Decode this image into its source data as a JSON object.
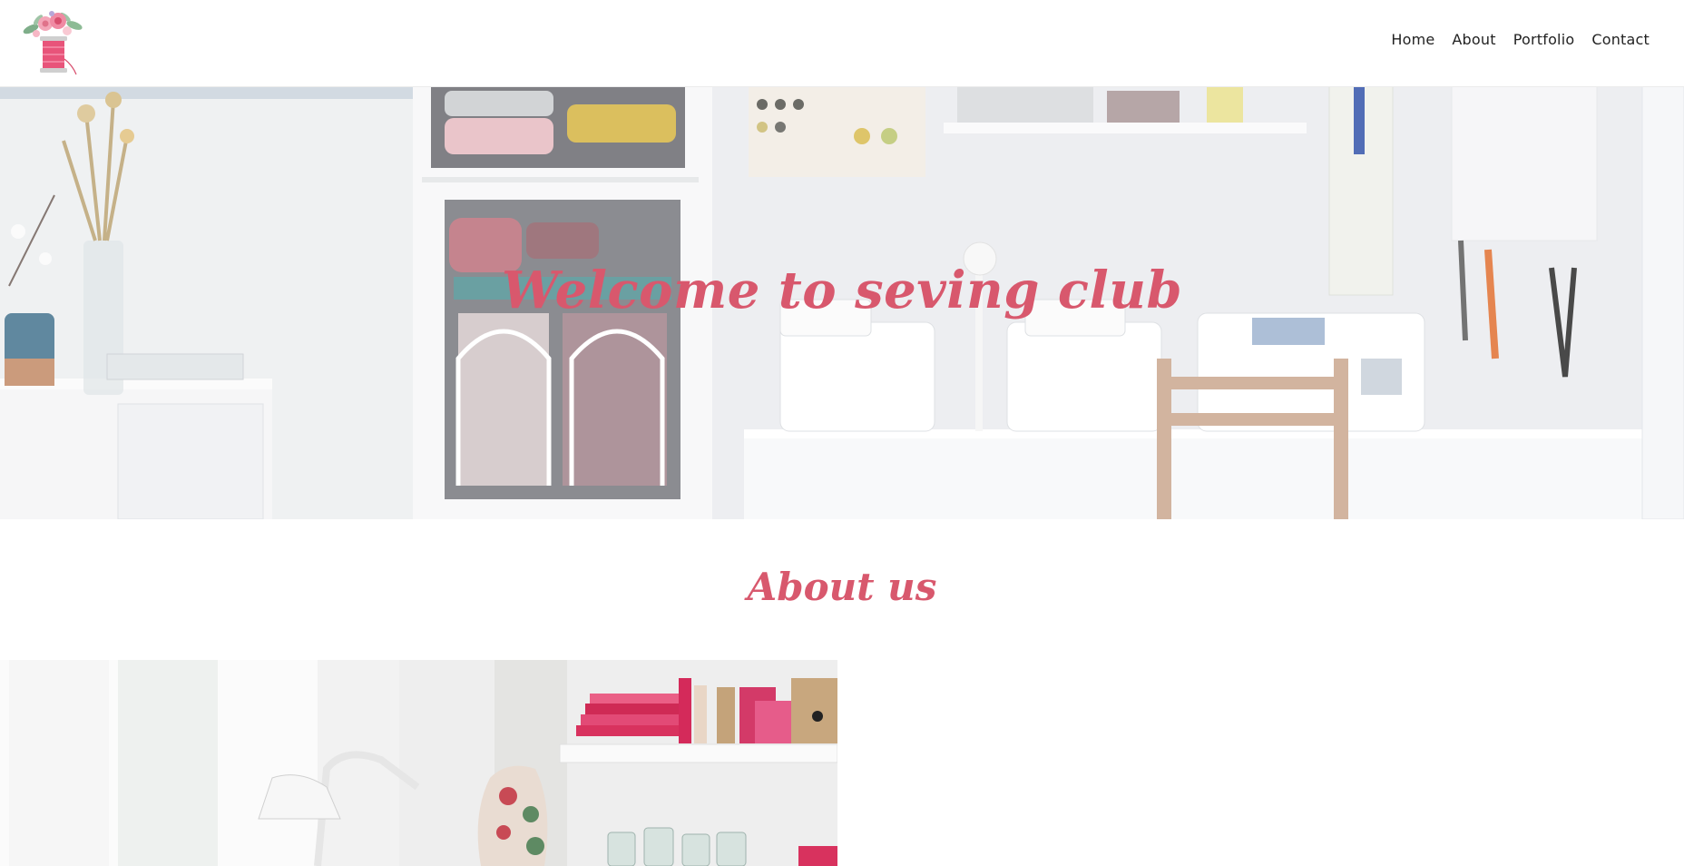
{
  "header": {
    "logo_alt": "Sewing club logo",
    "nav": [
      {
        "label": "Home"
      },
      {
        "label": "About"
      },
      {
        "label": "Portfolio"
      },
      {
        "label": "Contact"
      }
    ]
  },
  "hero": {
    "title": "Welcome to seving club"
  },
  "about": {
    "title": "About us"
  },
  "colors": {
    "accent": "#d8586d",
    "nav_text": "#222222",
    "background": "#ffffff"
  }
}
